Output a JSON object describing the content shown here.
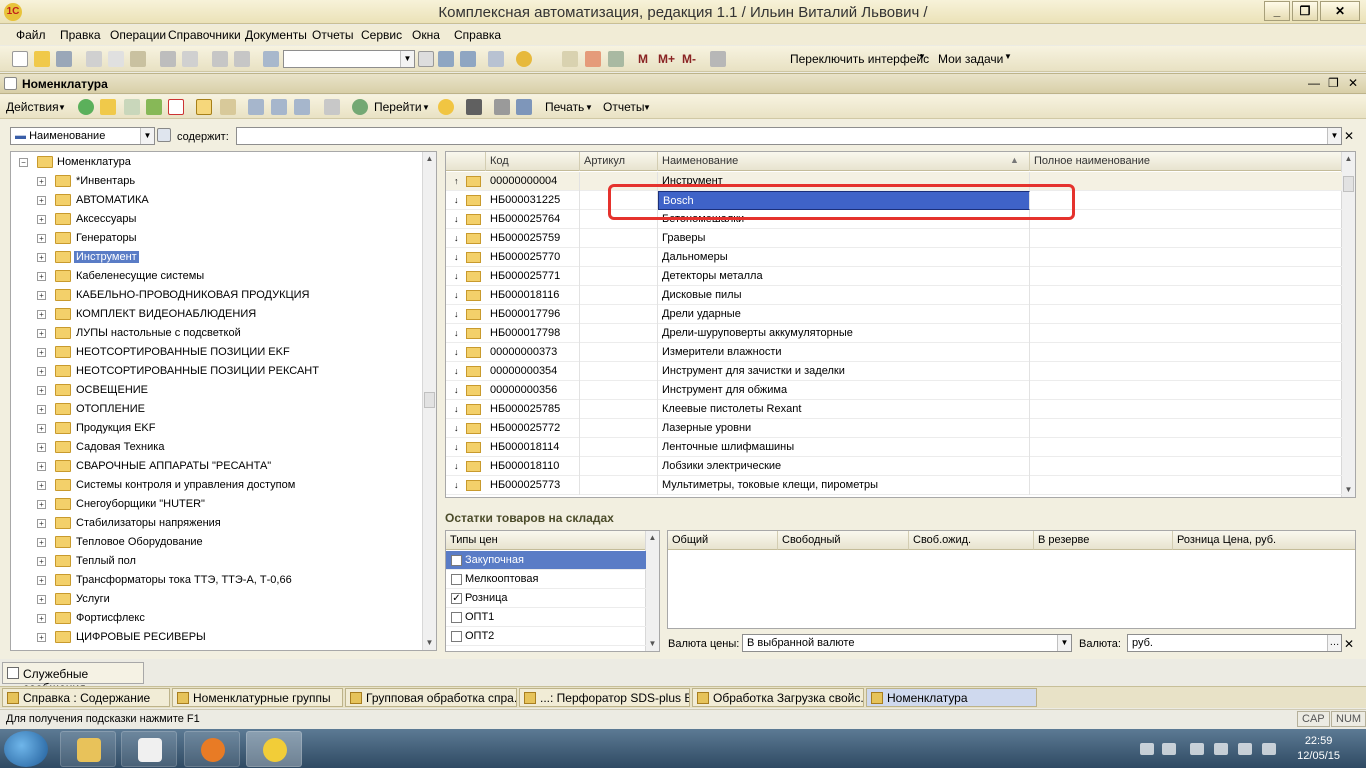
{
  "window": {
    "title": "Комплексная автоматизация, редакция 1.1 / Ильин Виталий Львович /",
    "logo_text": "1С"
  },
  "menu": [
    "Файл",
    "Правка",
    "Операции",
    "Справочники",
    "Документы",
    "Отчеты",
    "Сервис",
    "Окна",
    "Справка"
  ],
  "toolbar": {
    "switch_interface": "Переключить интерфейс",
    "my_tasks": "Мои задачи",
    "memory": [
      "M",
      "M+",
      "M-"
    ]
  },
  "document": {
    "title": "Номенклатура",
    "actions_label": "Действия",
    "goto_label": "Перейти",
    "print_label": "Печать",
    "reports_label": "Отчеты"
  },
  "filter": {
    "field": "Наименование",
    "contains_label": "содержит:",
    "value": ""
  },
  "tree": {
    "root": "Номенклатура",
    "items": [
      "*Инвентарь",
      "АВТОМАТИКА",
      "Аксессуары",
      "Генераторы",
      "Инструмент",
      "Кабеленесущие системы",
      "КАБЕЛЬНО-ПРОВОДНИКОВАЯ ПРОДУКЦИЯ",
      "КОМПЛЕКТ ВИДЕОНАБЛЮДЕНИЯ",
      "ЛУПЫ настольные с подсветкой",
      "НЕОТСОРТИРОВАННЫЕ ПОЗИЦИИ EKF",
      "НЕОТСОРТИРОВАННЫЕ ПОЗИЦИИ РЕКСАНТ",
      "ОСВЕЩЕНИЕ",
      "ОТОПЛЕНИЕ",
      "Продукция EKF",
      "Садовая Техника",
      "СВАРОЧНЫЕ АППАРАТЫ \"РЕСАНТА\"",
      "Системы контроля и управления доступом",
      "Снегоуборщики \"HUTER\"",
      "Стабилизаторы напряжения",
      "Тепловое Оборудование",
      "Теплый пол",
      "Трансформаторы тока ТТЭ, ТТЭ-А, Т-0,66",
      "Услуги",
      "Фортисфлекс",
      "ЦИФРОВЫЕ РЕСИВЕРЫ"
    ],
    "selected_index": 4
  },
  "grid": {
    "columns": [
      "Код",
      "Артикул",
      "Наименование",
      "Полное наименование"
    ],
    "rows": [
      {
        "code": "00000000004",
        "article": "",
        "name": "Инструмент",
        "full": ""
      },
      {
        "code": "НБ000031225",
        "article": "",
        "name": "Bosch",
        "full": ""
      },
      {
        "code": "НБ000025764",
        "article": "",
        "name": "Бетономешалки",
        "full": ""
      },
      {
        "code": "НБ000025759",
        "article": "",
        "name": "Граверы",
        "full": ""
      },
      {
        "code": "НБ000025770",
        "article": "",
        "name": "Дальномеры",
        "full": ""
      },
      {
        "code": "НБ000025771",
        "article": "",
        "name": "Детекторы металла",
        "full": ""
      },
      {
        "code": "НБ000018116",
        "article": "",
        "name": "Дисковые пилы",
        "full": ""
      },
      {
        "code": "НБ000017796",
        "article": "",
        "name": "Дрели ударные",
        "full": ""
      },
      {
        "code": "НБ000017798",
        "article": "",
        "name": "Дрели-шуруповерты аккумуляторные",
        "full": ""
      },
      {
        "code": "00000000373",
        "article": "",
        "name": "Измерители влажности",
        "full": ""
      },
      {
        "code": "00000000354",
        "article": "",
        "name": "Инструмент для зачистки и заделки",
        "full": ""
      },
      {
        "code": "00000000356",
        "article": "",
        "name": "Инструмент для обжима",
        "full": ""
      },
      {
        "code": "НБ000025785",
        "article": "",
        "name": "Клеевые пистолеты Rexant",
        "full": ""
      },
      {
        "code": "НБ000025772",
        "article": "",
        "name": "Лазерные уровни",
        "full": ""
      },
      {
        "code": "НБ000018114",
        "article": "",
        "name": "Ленточные шлифмашины",
        "full": ""
      },
      {
        "code": "НБ000018110",
        "article": "",
        "name": "Лобзики электрические",
        "full": ""
      },
      {
        "code": "НБ000025773",
        "article": "",
        "name": "Мультиметры, токовые клещи, пирометры",
        "full": ""
      }
    ]
  },
  "stock": {
    "title": "Остатки товаров на складах",
    "price_types_header": "Типы цен",
    "price_types": [
      {
        "label": "Закупочная",
        "checked": false
      },
      {
        "label": "Мелкооптовая",
        "checked": false
      },
      {
        "label": "Розница",
        "checked": true
      },
      {
        "label": "ОПТ1",
        "checked": false
      },
      {
        "label": "ОПТ2",
        "checked": false
      }
    ],
    "columns": [
      "Общий",
      "Свободный",
      "Своб.ожид.",
      "В резерве",
      "Розница Цена, руб."
    ],
    "currency_label": "Валюта цены:",
    "currency_value": "В выбранной валюте",
    "valuta_label": "Валюта:",
    "valuta_value": "руб."
  },
  "service_messages": "Служебные сообщения",
  "window_tabs": [
    "Справка : Содержание",
    "Номенклатурные группы",
    "Групповая обработка спра...",
    "...: Перфоратор SDS-plus Bo...",
    "Обработка  Загрузка свойс...",
    "Номенклатура"
  ],
  "status": {
    "hint": "Для получения подсказки нажмите F1",
    "cap": "CAP",
    "num": "NUM"
  },
  "os": {
    "time": "22:59",
    "date": "12/05/15"
  }
}
